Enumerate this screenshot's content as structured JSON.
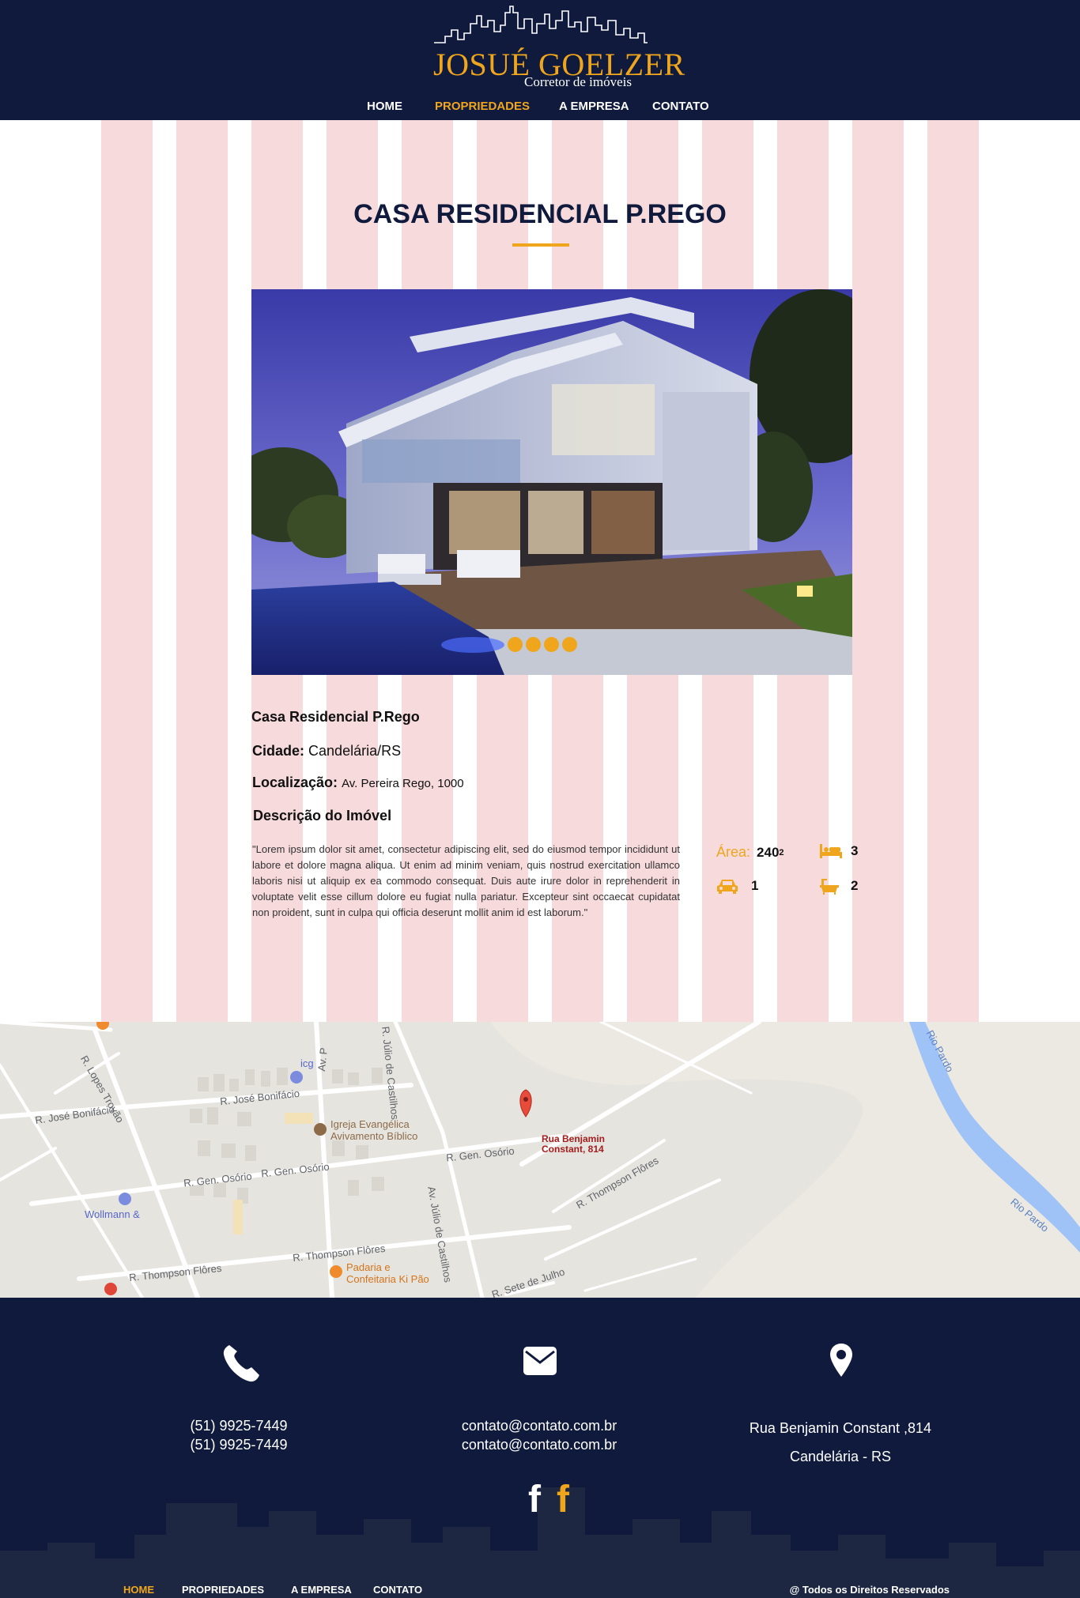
{
  "header": {
    "logo_title": "JOSUÉ GOELZER",
    "logo_subtitle": "Corretor de imóveis",
    "nav": [
      {
        "label": "HOME",
        "active": false
      },
      {
        "label": "PROPRIEDADES",
        "active": true
      },
      {
        "label": "A EMPRESA",
        "active": false
      },
      {
        "label": "CONTATO",
        "active": false
      }
    ]
  },
  "property": {
    "page_title": "CASA RESIDENCIAL P.REGO",
    "gallery_dots": 4,
    "name": "Casa Residencial P.Rego",
    "city_label": "Cidade:",
    "city_value": "Candelária/RS",
    "location_label": "Localização:",
    "location_value": "Av. Pereira Rego, 1000",
    "description_title": "Descrição do Imóvel",
    "description_text": "\"Lorem ipsum dolor sit amet, consectetur adipiscing elit, sed do eiusmod tempor incididunt ut labore et dolore magna aliqua. Ut enim ad minim veniam, quis nostrud exercitation ullamco laboris nisi ut aliquip ex ea commodo consequat. Duis aute irure dolor in reprehenderit in voluptate velit esse cillum dolore eu fugiat nulla pariatur. Excepteur sint occaecat cupidatat non proident, sunt in culpa qui officia deserunt mollit anim id est laborum.\"",
    "area_label": "Área:",
    "area_value": "240",
    "area_unit_sup": "2",
    "bedrooms": "3",
    "parking": "1",
    "bathrooms": "2"
  },
  "map": {
    "pin_label_line1": "Rua Benjamin",
    "pin_label_line2": "Constant, 814",
    "streets": {
      "lopes_trovao": "R. Lopes Trovão",
      "jose_bonifacio_1": "R. José Bonifácio",
      "jose_bonifacio_2": "R. José Bonifácio",
      "av_p": "Av. P",
      "julio_castilhos_1": "R. Júlio de Castilhos",
      "julio_castilhos_2": "Av. Júlio de Castilhos",
      "gen_osorio_1": "R. Gen. Osório",
      "gen_osorio_2": "R. Gen. Osório",
      "gen_osorio_3": "R. Gen. Osório",
      "thompson_1": "R. Thompson Flôres",
      "thompson_2": "R. Thompson Flôres",
      "thompson_3": "R. Thompson Flôres",
      "sete_julho": "R. Sete de Julho",
      "rio_pardo_1": "Rio Pardo",
      "rio_pardo_2": "Rio Pardo"
    },
    "places": {
      "icg": "icg",
      "igreja_1": "Igreja Evangélica",
      "igreja_2": "Avivamento Bíblico",
      "wollmann": "Wollmann &",
      "padaria_1": "Padaria e",
      "padaria_2": "Confeitaria Ki Pão"
    }
  },
  "footer": {
    "phone_1": "(51) 9925-7449",
    "phone_2": "(51) 9925-7449",
    "email_1": "contato@contato.com.br",
    "email_2": "contato@contato.com.br",
    "address_1": "Rua Benjamin Constant ,814",
    "address_2": "Candelária - RS",
    "nav": [
      "HOME",
      "PROPRIEDADES",
      "A EMPRESA",
      "CONTATO"
    ],
    "rights": "@ Todos os Direitos Reservados"
  },
  "colors": {
    "navy": "#0f1a3d",
    "accent": "#f0a61c",
    "stripe": "#f6dadc"
  },
  "icons": {
    "bed": "bed-icon",
    "car": "car-icon",
    "bath": "bathtub-icon",
    "phone": "phone-icon",
    "mail": "envelope-icon",
    "location": "map-pin-icon",
    "facebook": "facebook-icon"
  }
}
